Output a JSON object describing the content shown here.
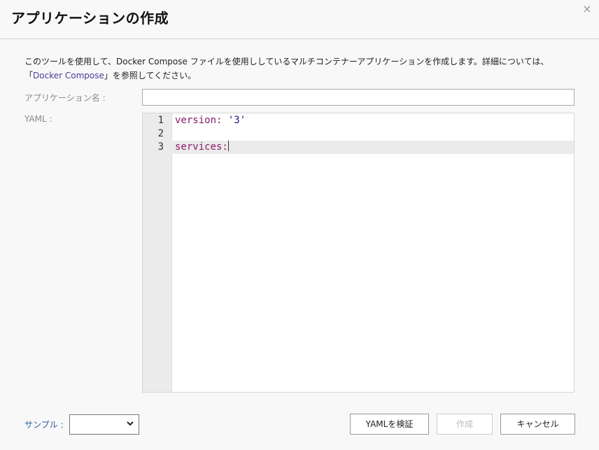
{
  "dialog": {
    "title": "アプリケーションの作成",
    "close_icon": "×"
  },
  "description": {
    "line1": "このツールを使用して、Docker Compose ファイルを使用ししているマルチコンテナーアプリケーションを作成します。詳細については、",
    "open_bracket": "「",
    "link": "Docker Compose",
    "close_text": "」を参照してください。"
  },
  "form": {
    "app_name_label": "アプリケーション名 :",
    "app_name_value": "",
    "yaml_label": "YAML :"
  },
  "editor": {
    "lines": [
      {
        "num": "1",
        "key": "version:",
        "value": "'3'"
      },
      {
        "num": "2",
        "key": "",
        "value": ""
      },
      {
        "num": "3",
        "key": "services:",
        "value": ""
      }
    ],
    "active_line": 3
  },
  "footer": {
    "sample_label": "サンプル :",
    "sample_value": "",
    "validate_button": "YAMLを検証",
    "create_button": "作成",
    "cancel_button": "キャンセル"
  },
  "colors": {
    "keyword": "#8a1a6a",
    "string": "#1a1a8a",
    "link": "#4a3a9a"
  }
}
